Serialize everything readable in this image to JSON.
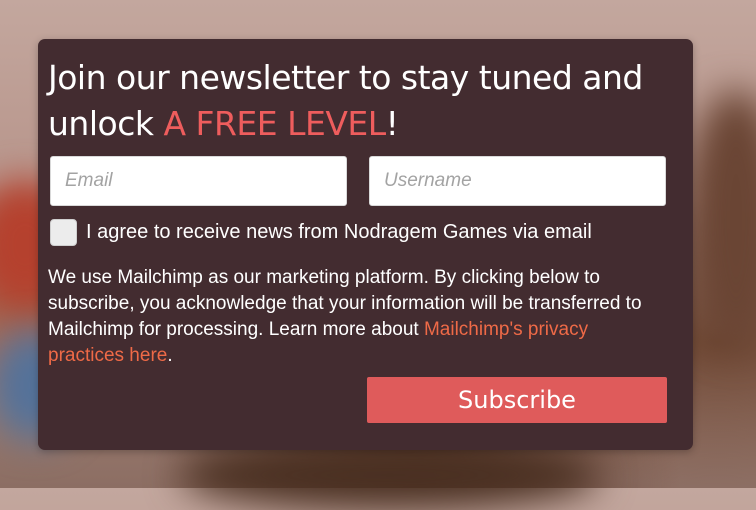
{
  "newsletter": {
    "headline_prefix": "Join our newsletter to stay tuned and unlock ",
    "headline_accent": "A FREE LEVEL",
    "headline_suffix": "!",
    "email_placeholder": "Email",
    "username_placeholder": "Username",
    "consent_label": "I agree to receive news from Nodragem Games via email",
    "notice_text": "We use Mailchimp as our marketing platform. By clicking below to subscribe, you acknowledge that your information will be transferred to Mailchimp for processing. Learn more about ",
    "notice_link": "Mailchimp's privacy practices here",
    "notice_end": ".",
    "subscribe_label": "Subscribe",
    "consent_checked": false
  },
  "colors": {
    "panel_bg": "#432c30",
    "accent": "#ee5d5d",
    "link": "#ef6a47",
    "button": "#df5b5b"
  }
}
